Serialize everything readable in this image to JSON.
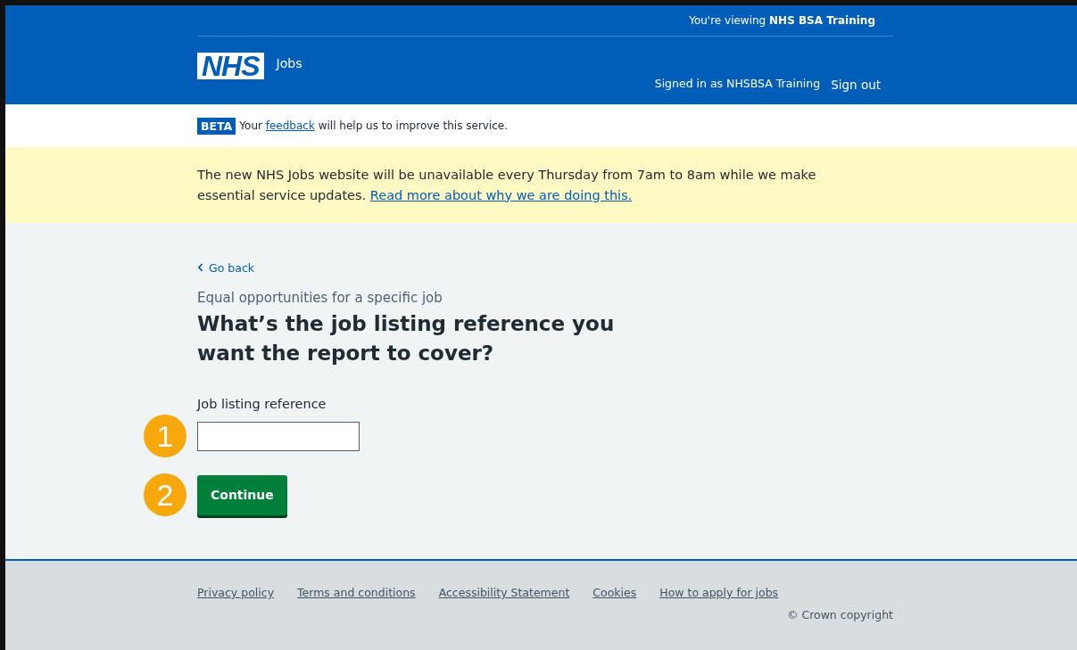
{
  "header": {
    "viewing": "You're viewing **NHS BSA Training**",
    "logo": "NHS",
    "service": "Jobs",
    "signed_in": "Signed in as NHSBSA Training",
    "sign_out": "Sign out"
  },
  "beta": {
    "tag": "BETA",
    "before": "Your",
    "link": "feedback",
    "after": "will help us to improve this service."
  },
  "notice": {
    "text": "The new NHS Jobs website will be unavailable every Thursday from 7am to 8am while we make essential service updates.",
    "link": "Read more about why we are doing this."
  },
  "back_link": "Go back",
  "caption": "Equal opportunities for a specific job",
  "heading": "What’s the job listing reference you want the report to cover?",
  "field": {
    "label": "Job listing reference",
    "callout": "1"
  },
  "button": {
    "label": "Continue",
    "callout": "2"
  },
  "footer": {
    "links": [
      "Privacy policy",
      "Terms and conditions",
      "Accessibility Statement",
      "Cookies",
      "How to apply for jobs"
    ],
    "copyright": "© Crown copyright"
  }
}
